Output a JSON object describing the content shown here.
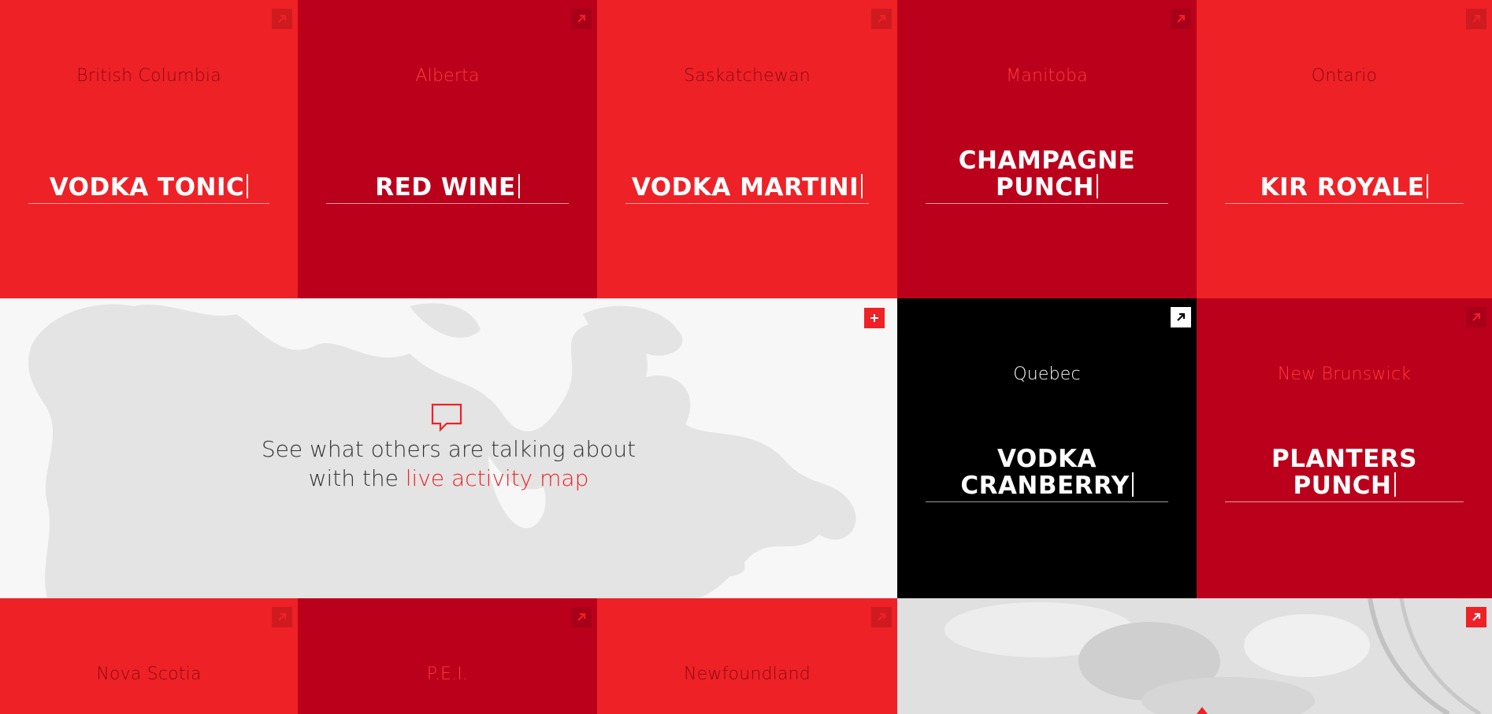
{
  "colors": {
    "bright_red": "#ee2127",
    "dark_red": "#bb001b",
    "black": "#000000",
    "map_background": "#f7f7f7"
  },
  "tiles": [
    {
      "province": "British Columbia",
      "drink": "VODKA TONIC",
      "theme": "bright",
      "icon": "external-link-icon"
    },
    {
      "province": "Alberta",
      "drink": "RED WINE",
      "theme": "dark",
      "icon": "external-link-icon"
    },
    {
      "province": "Saskatchewan",
      "drink": "VODKA MARTINI",
      "theme": "bright",
      "icon": "external-link-icon"
    },
    {
      "province": "Manitoba",
      "drink": "CHAMPAGNE\nPUNCH",
      "theme": "dark",
      "icon": "external-link-icon"
    },
    {
      "province": "Ontario",
      "drink": "KIR ROYALE",
      "theme": "bright",
      "icon": "external-link-icon"
    },
    {
      "province": "Quebec",
      "drink": "VODKA\nCRANBERRY",
      "theme": "black",
      "icon": "external-link-icon"
    },
    {
      "province": "New Brunswick",
      "drink": "PLANTERS\nPUNCH",
      "theme": "dark",
      "icon": "external-link-icon"
    },
    {
      "province": "Nova Scotia",
      "drink": "",
      "theme": "bright",
      "icon": "external-link-icon"
    },
    {
      "province": "P.E.I.",
      "drink": "",
      "theme": "dark",
      "icon": "external-link-icon"
    },
    {
      "province": "Newfoundland",
      "drink": "",
      "theme": "bright",
      "icon": "external-link-icon"
    }
  ],
  "map_promo": {
    "line1": "See what others are talking about",
    "line2_prefix": "with the ",
    "link": "live activity map",
    "icons": [
      "speech-bubble-icon",
      "plus-icon"
    ]
  },
  "photo_tile": {
    "icon": "external-link-icon"
  }
}
